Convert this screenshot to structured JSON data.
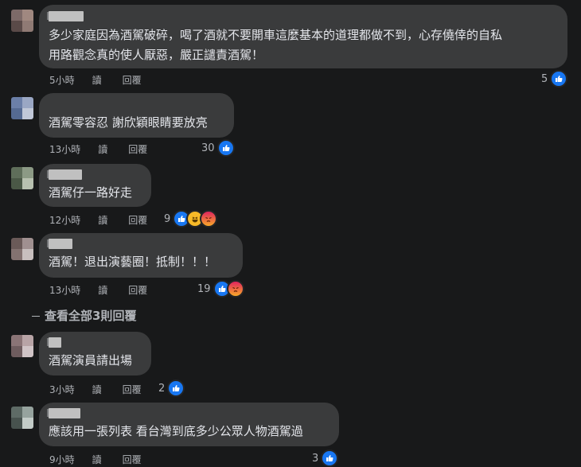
{
  "comments": [
    {
      "text": "多少家庭因為酒駕破碎，喝了酒就不要開車這麼基本的道理都做不到，心存僥倖的自私\n用路觀念真的使人厭惡，嚴正譴責酒駕！",
      "time": "5小時",
      "translate": "讀",
      "reply": "回覆",
      "reactions": "5"
    },
    {
      "text": "酒駕零容忍 謝欣穎眼睛要放亮",
      "time": "13小時",
      "translate": "讀",
      "reply": "回覆",
      "reactions": "30"
    },
    {
      "text": "酒駕仔一路好走",
      "time": "12小時",
      "translate": "讀",
      "reply": "回覆",
      "reactions": "9"
    },
    {
      "text": "酒駕！退出演藝圈！抵制！！！",
      "time": "13小時",
      "translate": "讀",
      "reply": "回覆",
      "reactions": "19"
    },
    {
      "text": "酒駕演員請出場",
      "time": "3小時",
      "translate": "讀",
      "reply": "回覆",
      "reactions": "2"
    },
    {
      "text": "應該用一張列表 看台灣到底多少公眾人物酒駕過",
      "time": "9小時",
      "translate": "讀",
      "reply": "回覆",
      "reactions": "3"
    }
  ],
  "view_more_replies": "查看全部3則回覆",
  "icons": {
    "like": "thumbs-up-icon",
    "haha": "laughing-face-icon",
    "angry": "angry-face-icon"
  },
  "colors": {
    "background": "#18191a",
    "bubble": "#3a3b3c",
    "like": "#1877f2",
    "meta_text": "#b0b3b8"
  }
}
